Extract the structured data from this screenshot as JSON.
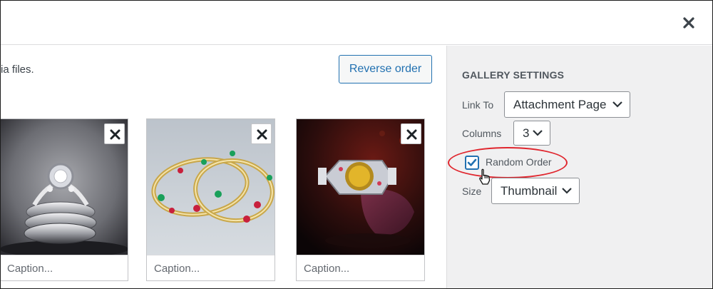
{
  "header": {
    "close_icon": "close-icon"
  },
  "main": {
    "intro_text": "ia files.",
    "reverse_order_label": "Reverse order",
    "images": [
      {
        "caption_placeholder": "Caption...",
        "subject": "stacked diamond rings"
      },
      {
        "caption_placeholder": "Caption...",
        "subject": "gold bangles with gems"
      },
      {
        "caption_placeholder": "Caption...",
        "subject": "jeweled watch"
      }
    ]
  },
  "settings": {
    "title": "GALLERY SETTINGS",
    "link_to": {
      "label": "Link To",
      "value": "Attachment Page"
    },
    "columns": {
      "label": "Columns",
      "value": "3"
    },
    "random_order": {
      "label": "Random Order",
      "checked": true
    },
    "size": {
      "label": "Size",
      "value": "Thumbnail"
    }
  },
  "colors": {
    "accent": "#2271b1",
    "highlight": "#e0262e",
    "sidebar_bg": "#f0f0f1"
  }
}
